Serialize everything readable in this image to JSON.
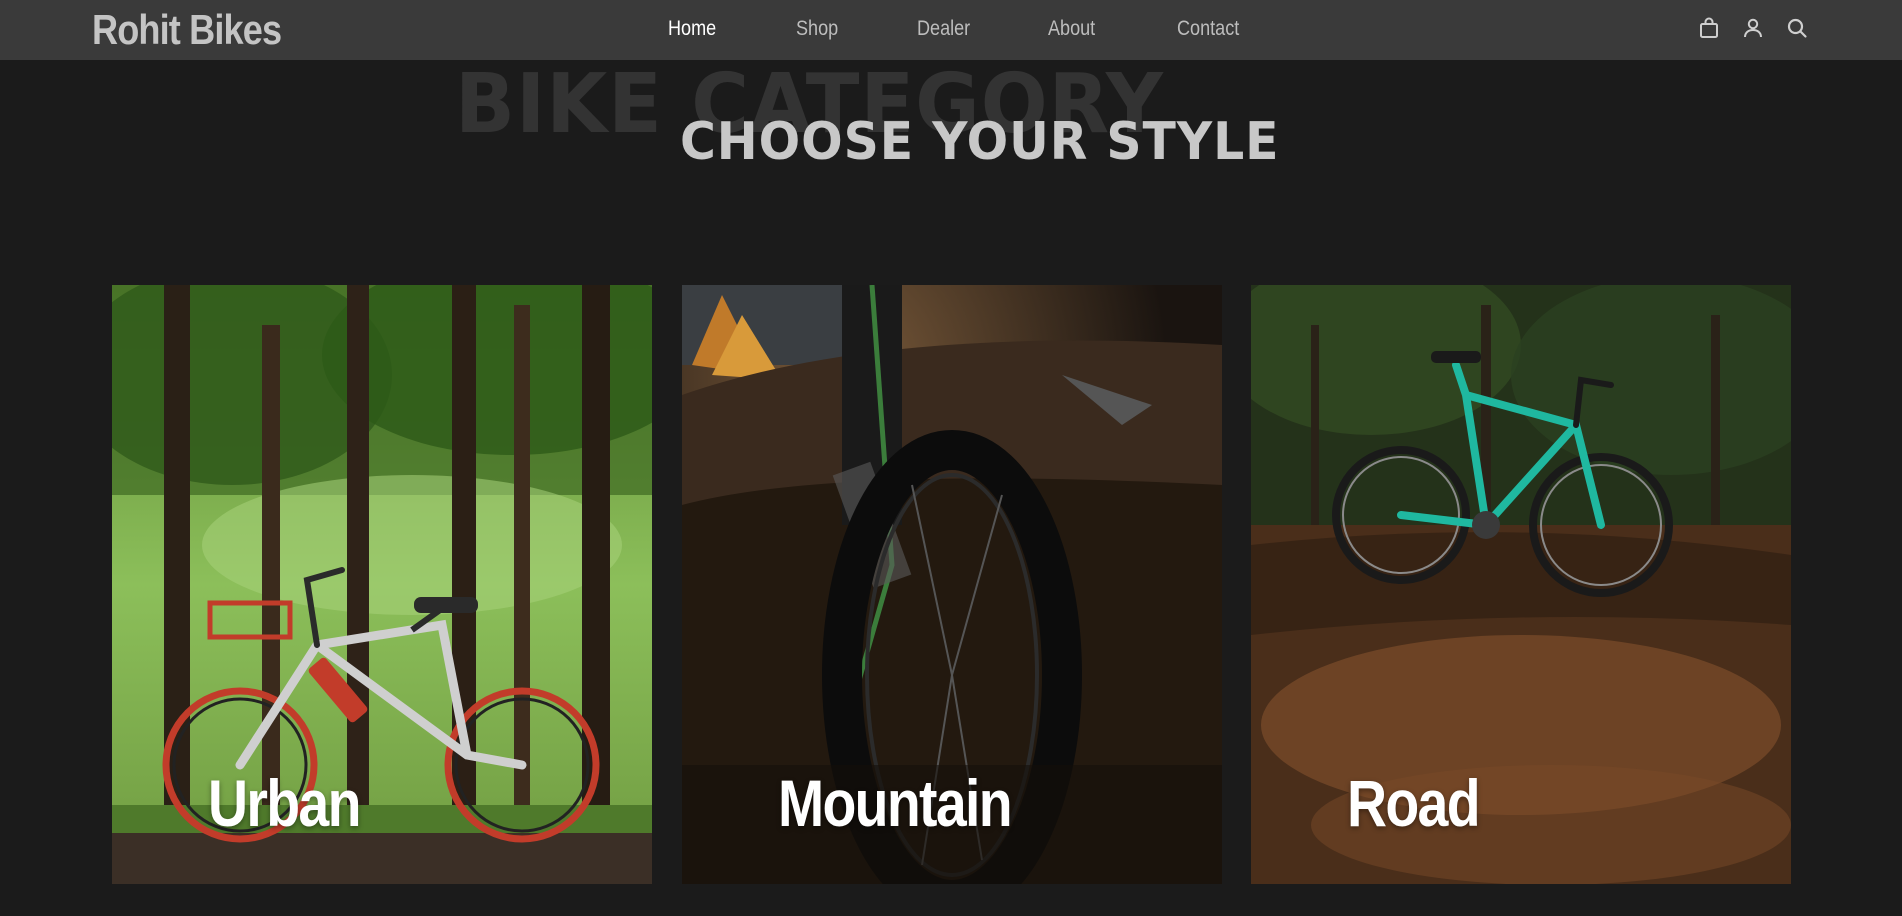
{
  "brand": "Rohit Bikes",
  "nav": {
    "links": [
      "Home",
      "Shop",
      "Dealer",
      "About",
      "Contact"
    ],
    "active": "Home",
    "icons": [
      "cart-icon",
      "user-icon",
      "search-icon"
    ]
  },
  "section": {
    "background_title": "BIKE CATEGORY",
    "title": "CHOOSE YOUR STYLE"
  },
  "categories": [
    {
      "label": "Urban",
      "image": "red-white-city-bike-in-forest"
    },
    {
      "label": "Mountain",
      "image": "fat-tire-mountain-bike-close-up"
    },
    {
      "label": "Road",
      "image": "teal-road-bike-on-autumn-leaves"
    }
  ],
  "colors": {
    "page_bg": "#1b1b1b",
    "nav_bg": "#3a3a3a",
    "text_muted": "#bdbdbd",
    "text_active": "#ffffff"
  }
}
